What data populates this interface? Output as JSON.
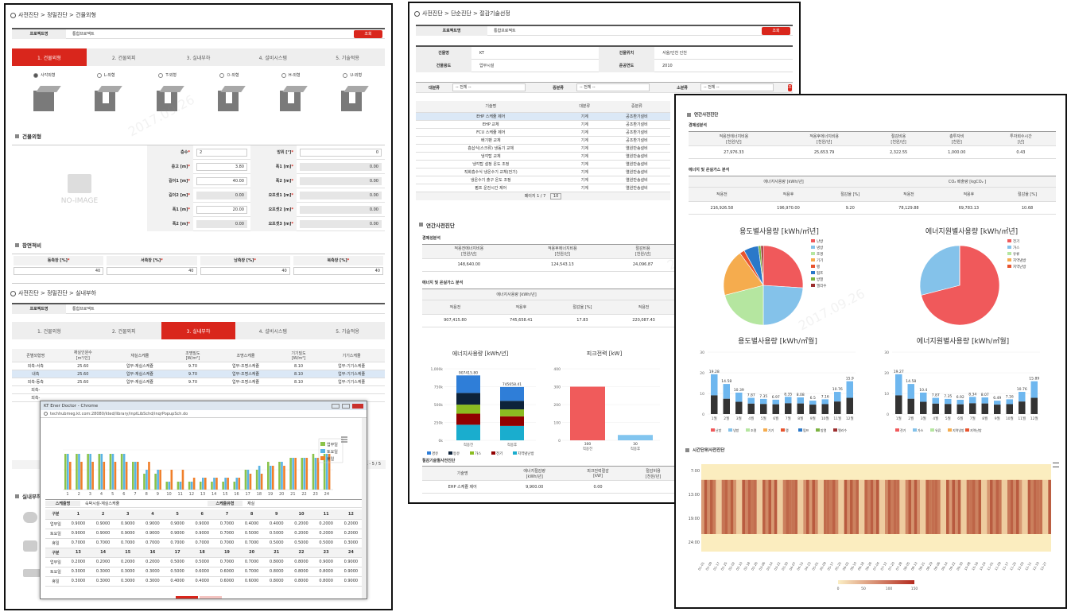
{
  "p1": {
    "breadcrumb": "사전진단 > 정밀진단 > 건물외형",
    "project_label": "프로젝트명",
    "project_value": "통합프로젝트",
    "query_button": "조회",
    "steps": [
      "1. 건물외형",
      "2. 건물외피",
      "3. 실내부하",
      "4. 설비시스템",
      "5. 기술적용"
    ],
    "shapes": [
      "사각외형",
      "L-외형",
      "T-외형",
      "ㅁ-외형",
      "H-외형",
      "U-외형"
    ],
    "section_building": "건물외형",
    "no_image": "NO-IMAGE",
    "fields_left": [
      {
        "label": "층수",
        "value": "2",
        "select": true
      },
      {
        "label": "층고 [m]",
        "value": "3.80"
      },
      {
        "label": "길이1 [m]",
        "value": "40.00"
      },
      {
        "label": "길이2 [m]",
        "value": "0.00",
        "disabled": true
      },
      {
        "label": "폭1 [m]",
        "value": "20.00"
      },
      {
        "label": "폭2 [m]",
        "value": "0.00",
        "disabled": true
      }
    ],
    "fields_right": [
      {
        "label": "방위 [°]",
        "value": "0"
      },
      {
        "label": "폭1 [m]",
        "value": "0.00",
        "disabled": true
      },
      {
        "label": "폭2 [m]",
        "value": "0.00",
        "disabled": true
      },
      {
        "label": "오프셋1 [m]",
        "value": "0.00",
        "disabled": true
      },
      {
        "label": "오프셋2 [m]",
        "value": "0.00",
        "disabled": true
      },
      {
        "label": "오프셋3 [m]",
        "value": "0.00",
        "disabled": true
      }
    ],
    "section_window": "창면적비",
    "window_labels": [
      "동측창 [%]",
      "서측창 [%]",
      "남측창 [%]",
      "북측창 [%]"
    ],
    "window_values": [
      "40",
      "40",
      "40",
      "40"
    ],
    "breadcrumb2": "사전진단 > 정밀진단 > 실내부하",
    "load_headers": [
      "존별외형명",
      "재실인원수\n[m²/인]",
      "재실스케쥴",
      "조명밀도\n[W/m²]",
      "조명스케쥴",
      "기기밀도\n[W/m²]",
      "기기스케쥴"
    ],
    "load_rows": [
      [
        "외측-서측",
        "25.60",
        "업무-재실스케쥴",
        "9.70",
        "업무-조명스케쥴",
        "8.10",
        "업무-기기스케쥴"
      ],
      [
        "내측",
        "25.60",
        "업무-재실스케쥴",
        "9.70",
        "업무-조명스케쥴",
        "8.10",
        "업무-기기스케쥴"
      ],
      [
        "외측-동측",
        "25.60",
        "업무-재실스케쥴",
        "9.70",
        "업무-조명스케쥴",
        "8.10",
        "업무-기기스케쥴"
      ],
      [
        "외측-",
        "",
        "",
        "",
        "",
        "",
        ""
      ],
      [
        "외측-",
        "",
        "",
        "",
        "",
        "",
        ""
      ]
    ],
    "load_pager": "1 - 5 / 5",
    "section_indoor": "실내부하"
  },
  "popup": {
    "title": "KT Ener Doctor - Chrome",
    "url": "techhubmeg.kt.com:28080/kted/library/inptLibSchd/inqrPopupSch.do",
    "legend": [
      "업무일",
      "토요일",
      "휴일"
    ],
    "legend_colors": [
      "#8bc34a",
      "#5ab4e5",
      "#f07f2a"
    ],
    "x_ticks": [
      "1",
      "2",
      "3",
      "4",
      "5",
      "6",
      "7",
      "8",
      "9",
      "10",
      "11",
      "12",
      "13",
      "14",
      "15",
      "16",
      "17",
      "18",
      "19",
      "20",
      "21",
      "22",
      "23",
      "24"
    ],
    "schedule_name_label": "스케쥴명",
    "schedule_name": "숙박시설-재실스케쥴",
    "schedule_type_label": "스케쥴유형",
    "schedule_type": "재실",
    "hours1": [
      "구분",
      "1",
      "2",
      "3",
      "4",
      "5",
      "6",
      "7",
      "8",
      "9",
      "10",
      "11",
      "12"
    ],
    "hours2": [
      "구분",
      "13",
      "14",
      "15",
      "16",
      "17",
      "18",
      "19",
      "20",
      "21",
      "22",
      "23",
      "24"
    ],
    "rows1": [
      [
        "업무일",
        "0.9000",
        "0.9000",
        "0.9000",
        "0.9000",
        "0.9000",
        "0.9000",
        "0.7000",
        "0.4000",
        "0.4000",
        "0.2000",
        "0.2000",
        "0.2000"
      ],
      [
        "토요일",
        "0.9000",
        "0.9000",
        "0.9000",
        "0.9000",
        "0.9000",
        "0.9000",
        "0.7000",
        "0.5000",
        "0.5000",
        "0.2000",
        "0.2000",
        "0.2000"
      ],
      [
        "휴일",
        "0.7000",
        "0.7000",
        "0.7000",
        "0.7000",
        "0.7000",
        "0.7000",
        "0.7000",
        "0.7000",
        "0.5000",
        "0.5000",
        "0.5000",
        "0.3000"
      ]
    ],
    "rows2": [
      [
        "업무일",
        "0.2000",
        "0.2000",
        "0.2000",
        "0.2000",
        "0.5000",
        "0.5000",
        "0.7000",
        "0.7000",
        "0.8000",
        "0.8000",
        "0.9000",
        "0.9000"
      ],
      [
        "토요일",
        "0.3000",
        "0.3000",
        "0.3000",
        "0.3000",
        "0.5000",
        "0.6000",
        "0.6000",
        "0.7000",
        "0.8000",
        "0.8000",
        "0.8000",
        "0.9000"
      ],
      [
        "휴일",
        "0.3000",
        "0.3000",
        "0.3000",
        "0.3000",
        "0.4000",
        "0.4000",
        "0.6000",
        "0.6000",
        "0.8000",
        "0.8000",
        "0.8000",
        "0.9000"
      ]
    ],
    "series": {
      "work": [
        0.9,
        0.9,
        0.9,
        0.9,
        0.9,
        0.9,
        0.7,
        0.4,
        0.4,
        0.2,
        0.2,
        0.2,
        0.2,
        0.2,
        0.2,
        0.2,
        0.5,
        0.5,
        0.7,
        0.7,
        0.8,
        0.8,
        0.9,
        0.9
      ],
      "sat": [
        0.9,
        0.9,
        0.9,
        0.9,
        0.9,
        0.9,
        0.7,
        0.5,
        0.5,
        0.2,
        0.2,
        0.2,
        0.3,
        0.3,
        0.3,
        0.3,
        0.5,
        0.6,
        0.6,
        0.7,
        0.8,
        0.8,
        0.8,
        0.9
      ],
      "hol": [
        0.7,
        0.7,
        0.7,
        0.7,
        0.7,
        0.7,
        0.7,
        0.7,
        0.5,
        0.5,
        0.5,
        0.3,
        0.3,
        0.3,
        0.3,
        0.3,
        0.4,
        0.4,
        0.6,
        0.6,
        0.8,
        0.8,
        0.8,
        0.9
      ]
    }
  },
  "p2": {
    "breadcrumb": "사전진단 > 단순진단 > 절감기술선정",
    "project_label": "프로젝트명",
    "project_value": "통합프로젝트",
    "query_button": "조회",
    "info": [
      {
        "label": "건물명",
        "value": "KT",
        "label2": "건물위치",
        "value2": "서울/인천 인천"
      },
      {
        "label": "건물용도",
        "value": "업무시설",
        "label2": "준공연도",
        "value2": "2010"
      }
    ],
    "filters": [
      {
        "label": "대분류",
        "value": "-- 전체 --"
      },
      {
        "label": "중분류",
        "value": "-- 전체 --"
      },
      {
        "label": "소분류",
        "value": "-- 전체 --"
      }
    ],
    "tech_headers": [
      "기술명",
      "대분류",
      "중분류"
    ],
    "tech_rows": [
      [
        "EHP 스케쥴 제어",
        "기계",
        "공조환기설비"
      ],
      [
        "EHP 교체",
        "기계",
        "공조환기설비"
      ],
      [
        "FCU 스케쥴 제어",
        "기계",
        "공조환기설비"
      ],
      [
        "배기팬 교체",
        "기계",
        "공조환기설비"
      ],
      [
        "흡삽식(스크류) 냉동기 교체",
        "기계",
        "열원반송설비"
      ],
      [
        "냉각탑 교체",
        "기계",
        "열원반송설비"
      ],
      [
        "냉각탑 설정 온도 조정",
        "기계",
        "열원반송설비"
      ],
      [
        "직화흡수식 냉온수기 교체(전기)",
        "기계",
        "열원반송설비"
      ],
      [
        "냉온수기 출구 온도 조정",
        "기계",
        "열원반송설비"
      ],
      [
        "펌프 운전시간 제어",
        "기계",
        "열원반송설비"
      ]
    ],
    "pager": "페이지 1 / 7",
    "pager_size": "10",
    "section_annual": "연간사전진단",
    "eco_title": "경제성분석",
    "eco_headers": [
      "적용전에너지비용\n[천원/년]",
      "적용후에너지비용\n[천원/년]",
      "절감비용\n[천원/년]"
    ],
    "eco_values": [
      "148,640.00",
      "124,543.13",
      "24,096.87"
    ],
    "energy_title": "에너지 및 온실가스 분석",
    "energy_group": "에너지사용량 [kWh/년]",
    "energy_headers": [
      "적용전",
      "적용후",
      "절감율 [%]",
      "적용전"
    ],
    "energy_values": [
      "907,415.80",
      "745,658.41",
      "17.83",
      "220,087.43"
    ],
    "chart1_title": "에너지사용량 [kWh/년]",
    "chart1_labels": [
      "907415.80",
      "745658.41"
    ],
    "chart1_x": [
      "적용전",
      "적용후"
    ],
    "chart1_ticks": [
      "1,000k",
      "750k",
      "500k",
      "250k",
      "0k"
    ],
    "chart1_legend": [
      "경유",
      "등유",
      "가스",
      "전기",
      "지역냉난방"
    ],
    "chart1_colors": [
      "#2f7ed8",
      "#0d233a",
      "#8bbc21",
      "#910000",
      "#1aadce"
    ],
    "chart2_title": "피크전력 [kW]",
    "chart2_values": [
      "300",
      "30"
    ],
    "chart2_x": [
      "적용전",
      "적용후"
    ],
    "chart2_ticks": [
      "400",
      "300",
      "200",
      "100",
      "0"
    ],
    "sel_title": "절감기술별사전진단",
    "sel_headers": [
      "기술명",
      "에너지절감량\n[kWh/년]",
      "피크전력절감\n[kW]",
      "절감비용\n[천원/년]"
    ],
    "sel_row": [
      "EHP 스케쥴 제어",
      "9,900.00",
      "0.00",
      ""
    ]
  },
  "p3": {
    "section": "연간사전진단",
    "eco_title": "경제성분석",
    "eco_headers": [
      "적용전에너지비용\n[천원/년]",
      "적용후에너지비용\n[천원/년]",
      "절감비용\n[천원/년]",
      "총투자비\n[천원]",
      "투자회수시간\n[년]"
    ],
    "eco_values": [
      "27,976.33",
      "25,653.79",
      "2,322.55",
      "1,000.00",
      "0.43"
    ],
    "energy_title": "에너지 및 온실가스 분석",
    "energy_group1": "에너지사용량 [kWh/년]",
    "energy_group2": "CO₂ 배출량 [kgCO₂ ]",
    "energy_headers": [
      "적용전",
      "적용후",
      "절감율 [%]",
      "적용전",
      "적용후",
      "절감율 [%]"
    ],
    "energy_values": [
      "216,926.58",
      "196,970.00",
      "9.20",
      "78,129.88",
      "69,783.13",
      "10.68"
    ],
    "pie1_title": "용도별사용량 [kWh/㎡년]",
    "pie1_legend": [
      "난방",
      "냉방",
      "조명",
      "기기",
      "팽",
      "펌프",
      "방열",
      "엘리수"
    ],
    "pie1_colors": [
      "#f0595b",
      "#84c2ea",
      "#b5e6a0",
      "#f5ac4e",
      "#e8542e",
      "#2a78c9",
      "#7cb342",
      "#9c2f2f"
    ],
    "pie2_title": "에너지원별사용량 [kWh/㎡년]",
    "pie2_legend": [
      "전기",
      "가스",
      "유류",
      "지역냉방",
      "지역난방"
    ],
    "pie2_colors": [
      "#f0595b",
      "#84c2ea",
      "#b5e6a0",
      "#f5ac4e",
      "#e8542e"
    ],
    "bar1_title": "용도별사용량 [kWh/㎡월]",
    "bar2_title": "에너지원별사용량 [kWh/㎡월]",
    "months": [
      "1월",
      "2월",
      "3월",
      "4월",
      "5월",
      "6월",
      "7월",
      "8월",
      "9월",
      "10월",
      "11월",
      "12월"
    ],
    "bar1_values": [
      19.28,
      14.58,
      10.39,
      7.87,
      7.35,
      6.97,
      8.35,
      8.08,
      6.5,
      7.16,
      10.76,
      15.9
    ],
    "bar2_values": [
      19.27,
      14.58,
      10.4,
      7.87,
      7.35,
      6.92,
      8.34,
      8.07,
      6.49,
      7.16,
      10.76,
      15.89
    ],
    "bar_ticks": [
      "30",
      "20",
      "10",
      "0"
    ],
    "bar1_legend": [
      "난방",
      "냉방",
      "조명",
      "기기",
      "팽",
      "펌프",
      "방열",
      "엘리수"
    ],
    "bar2_legend": [
      "전기",
      "가스",
      "유류",
      "지역냉방",
      "지역난방"
    ],
    "heat_title": "시간단위사전진단",
    "heat_yticks": [
      "7:00",
      "13:00",
      "19:00",
      "24:00"
    ],
    "heat_xticks": [
      "01-01",
      "01-09",
      "01-17",
      "01-25",
      "02-02",
      "02-10",
      "02-18",
      "02-26",
      "03-06",
      "03-14",
      "03-22",
      "03-30",
      "04-07",
      "04-15",
      "04-23",
      "05-01",
      "05-09",
      "05-17",
      "05-25",
      "06-02",
      "06-10",
      "06-18",
      "06-26",
      "07-04",
      "07-12",
      "07-20",
      "07-28",
      "08-05",
      "08-13",
      "08-21",
      "08-29",
      "09-06",
      "09-14",
      "09-22",
      "09-30",
      "10-08",
      "10-16",
      "10-24",
      "11-01",
      "11-09",
      "11-17",
      "11-25",
      "12-03",
      "12-11",
      "12-19",
      "12-27"
    ],
    "heat_scale": [
      "0",
      "50",
      "100",
      "150"
    ]
  }
}
